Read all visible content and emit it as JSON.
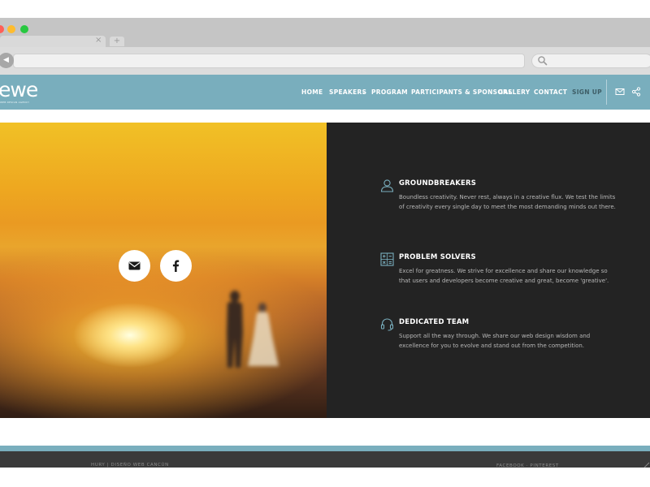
{
  "browser": {
    "window_controls": [
      "close",
      "minimize",
      "maximize"
    ],
    "colors": {
      "close": "#ff5f57",
      "minimize": "#febc2e",
      "maximize": "#28c840"
    },
    "tab_close_glyph": "×",
    "new_tab_glyph": "+",
    "back_glyph": "◀",
    "url": ""
  },
  "site": {
    "logo_text": "ewe",
    "logo_tagline": "WEB DESIGN AGENCY",
    "nav": [
      {
        "label": "HOME"
      },
      {
        "label": "SPEAKERS"
      },
      {
        "label": "PROGRAM"
      },
      {
        "label": "PARTICIPANTS & SPONSORS"
      },
      {
        "label": "GALLERY"
      },
      {
        "label": "CONTACT"
      },
      {
        "label": "SIGN UP"
      }
    ],
    "header_icons": [
      "mail-icon",
      "share-icon"
    ],
    "colors": {
      "header": "#79aebd",
      "dark_panel": "#232323",
      "signup": "#3e5e67"
    }
  },
  "hero": {
    "social_buttons": [
      "envelope-icon",
      "facebook-icon"
    ]
  },
  "features": [
    {
      "icon": "user-icon",
      "title": "GROUNDBREAKERS",
      "text": "Boundless creativity. Never rest, always in a creative flux. We test the limits of creativity every single day to meet the most demanding minds out there."
    },
    {
      "icon": "calculator-icon",
      "title": "PROBLEM SOLVERS",
      "text": "Excel for greatness. We strive for excellence and share our knowledge so that users and developers become creative and great, become 'greative'."
    },
    {
      "icon": "headset-icon",
      "title": "DEDICATED TEAM",
      "text": "Support all the way through. We share our web design wisdom and excellence for you to evolve and stand out from the competition."
    }
  ],
  "footer": {
    "left": "HURY | DISEÑO WEB CANCÚN",
    "right": "FACEBOOK · PINTEREST"
  }
}
